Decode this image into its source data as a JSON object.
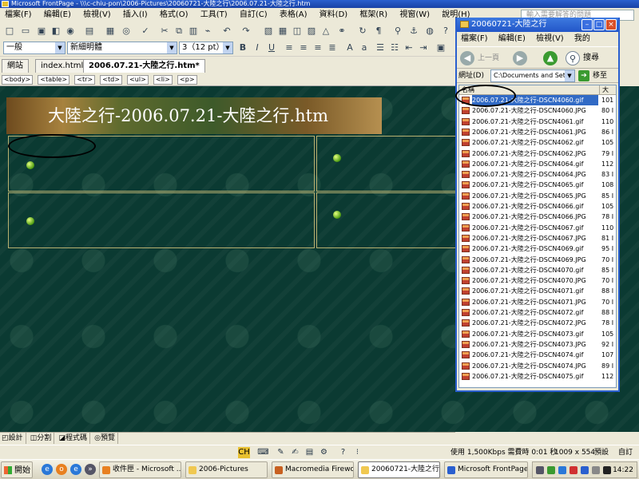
{
  "window": {
    "title": "Microsoft FrontPage - \\\\\\c-chiu-pon\\2006-Pictures\\20060721-大陸之行\\2006.07.21-大陸之行.htm"
  },
  "menubar": {
    "items": [
      "檔案(F)",
      "編輯(E)",
      "檢視(V)",
      "插入(I)",
      "格式(O)",
      "工具(T)",
      "自訂(C)",
      "表格(A)",
      "資料(D)",
      "框架(R)",
      "視窗(W)",
      "說明(H)"
    ],
    "help_hint": "輸入需要解答的問題"
  },
  "formatting": {
    "style": "一般",
    "font": "新細明體",
    "size": "3（12 pt）"
  },
  "tabs": [
    {
      "label": "網站"
    },
    {
      "label": "index.html*"
    },
    {
      "label": "2006.07.21-大陸之行.htm*"
    }
  ],
  "tag_selector": [
    "<body>",
    "<table>",
    "<tr>",
    "<td>",
    "<ul>",
    "<li>",
    "<p>"
  ],
  "page": {
    "banner_title": "大陸之行-2006.07.21-大陸之行.htm"
  },
  "view_tabs": [
    "設計",
    "分割",
    "程式碼",
    "預覽"
  ],
  "status": {
    "download_time": "使用 1,500Kbps 需費時 0:01 秒",
    "page_size": "1009 x 554",
    "mode1": "預設",
    "mode2": "自訂"
  },
  "file_window": {
    "title": "20060721-大陸之行",
    "menu": [
      "檔案(F)",
      "編輯(E)",
      "檢視(V)",
      "我的"
    ],
    "back_label": "上一頁",
    "search_label": "搜尋",
    "address_label": "網址(D)",
    "address_value": "C:\\Documents and Set",
    "go_label": "移至",
    "col_name": "名稱",
    "col_size": "大",
    "files": [
      {
        "name": "2006.07.21-大陸之行-DSCN4060.gif",
        "size": "101 I",
        "selected": true
      },
      {
        "name": "2006.07.21-大陸之行-DSCN4060.JPG",
        "size": "80 I"
      },
      {
        "name": "2006.07.21-大陸之行-DSCN4061.gif",
        "size": "110 I"
      },
      {
        "name": "2006.07.21-大陸之行-DSCN4061.JPG",
        "size": "86 I"
      },
      {
        "name": "2006.07.21-大陸之行-DSCN4062.gif",
        "size": "105 I"
      },
      {
        "name": "2006.07.21-大陸之行-DSCN4062.JPG",
        "size": "79 I"
      },
      {
        "name": "2006.07.21-大陸之行-DSCN4064.gif",
        "size": "112 I"
      },
      {
        "name": "2006.07.21-大陸之行-DSCN4064.JPG",
        "size": "83 I"
      },
      {
        "name": "2006.07.21-大陸之行-DSCN4065.gif",
        "size": "108 I"
      },
      {
        "name": "2006.07.21-大陸之行-DSCN4065.JPG",
        "size": "85 I"
      },
      {
        "name": "2006.07.21-大陸之行-DSCN4066.gif",
        "size": "105 I"
      },
      {
        "name": "2006.07.21-大陸之行-DSCN4066.JPG",
        "size": "78 I"
      },
      {
        "name": "2006.07.21-大陸之行-DSCN4067.gif",
        "size": "110 I"
      },
      {
        "name": "2006.07.21-大陸之行-DSCN4067.JPG",
        "size": "81 I"
      },
      {
        "name": "2006.07.21-大陸之行-DSCN4069.gif",
        "size": "95 I"
      },
      {
        "name": "2006.07.21-大陸之行-DSCN4069.JPG",
        "size": "70 I"
      },
      {
        "name": "2006.07.21-大陸之行-DSCN4070.gif",
        "size": "85 I"
      },
      {
        "name": "2006.07.21-大陸之行-DSCN4070.JPG",
        "size": "70 I"
      },
      {
        "name": "2006.07.21-大陸之行-DSCN4071.gif",
        "size": "88 I"
      },
      {
        "name": "2006.07.21-大陸之行-DSCN4071.JPG",
        "size": "70 I"
      },
      {
        "name": "2006.07.21-大陸之行-DSCN4072.gif",
        "size": "88 I"
      },
      {
        "name": "2006.07.21-大陸之行-DSCN4072.JPG",
        "size": "78 I"
      },
      {
        "name": "2006.07.21-大陸之行-DSCN4073.gif",
        "size": "105 I"
      },
      {
        "name": "2006.07.21-大陸之行-DSCN4073.JPG",
        "size": "92 I"
      },
      {
        "name": "2006.07.21-大陸之行-DSCN4074.gif",
        "size": "107 I"
      },
      {
        "name": "2006.07.21-大陸之行-DSCN4074.JPG",
        "size": "89 I"
      },
      {
        "name": "2006.07.21-大陸之行-DSCN4075.gif",
        "size": "112 I"
      }
    ]
  },
  "taskbar": {
    "start_label": "開始",
    "tasks": [
      {
        "label": "收件匣 - Microsoft ..."
      },
      {
        "label": "2006-Pictures"
      },
      {
        "label": "Macromedia Firewor..."
      },
      {
        "label": "20060721-大陸之行"
      },
      {
        "label": "Microsoft FrontPage ..."
      }
    ],
    "clock": "14:22"
  }
}
